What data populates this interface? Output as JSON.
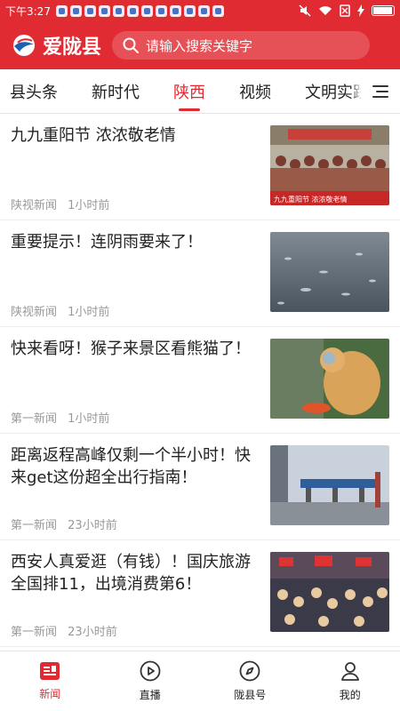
{
  "status_bar": {
    "time": "下午3:27"
  },
  "header": {
    "app_name": "爱陇县",
    "search_placeholder": "请输入搜索关键字"
  },
  "tabs": [
    {
      "label": "县头条"
    },
    {
      "label": "新时代"
    },
    {
      "label": "陕西",
      "active": true
    },
    {
      "label": "视频"
    },
    {
      "label": "文明实践"
    }
  ],
  "news": [
    {
      "title": "九九重阳节 浓浓敬老情",
      "source": "陕视新闻",
      "time": "1小时前",
      "thumb_caption": "九九重阳节 浓浓敬老情"
    },
    {
      "title": "重要提示！连阴雨要来了！",
      "source": "陕视新闻",
      "time": "1小时前"
    },
    {
      "title": "快来看呀！猴子来景区看熊猫了！",
      "source": "第一新闻",
      "time": "1小时前"
    },
    {
      "title": "距离返程高峰仅剩一个半小时！快来get这份超全出行指南！",
      "source": "第一新闻",
      "time": "23小时前"
    },
    {
      "title": "西安人真爱逛（有钱）！国庆旅游全国排11，出境消费第6！",
      "source": "第一新闻",
      "time": "23小时前"
    }
  ],
  "bottom_nav": [
    {
      "label": "新闻",
      "icon": "news-icon",
      "active": true
    },
    {
      "label": "直播",
      "icon": "play-icon"
    },
    {
      "label": "陇县号",
      "icon": "compass-icon"
    },
    {
      "label": "我的",
      "icon": "user-icon"
    }
  ],
  "colors": {
    "brand": "#e02b33",
    "text": "#222222",
    "meta": "#999999"
  }
}
